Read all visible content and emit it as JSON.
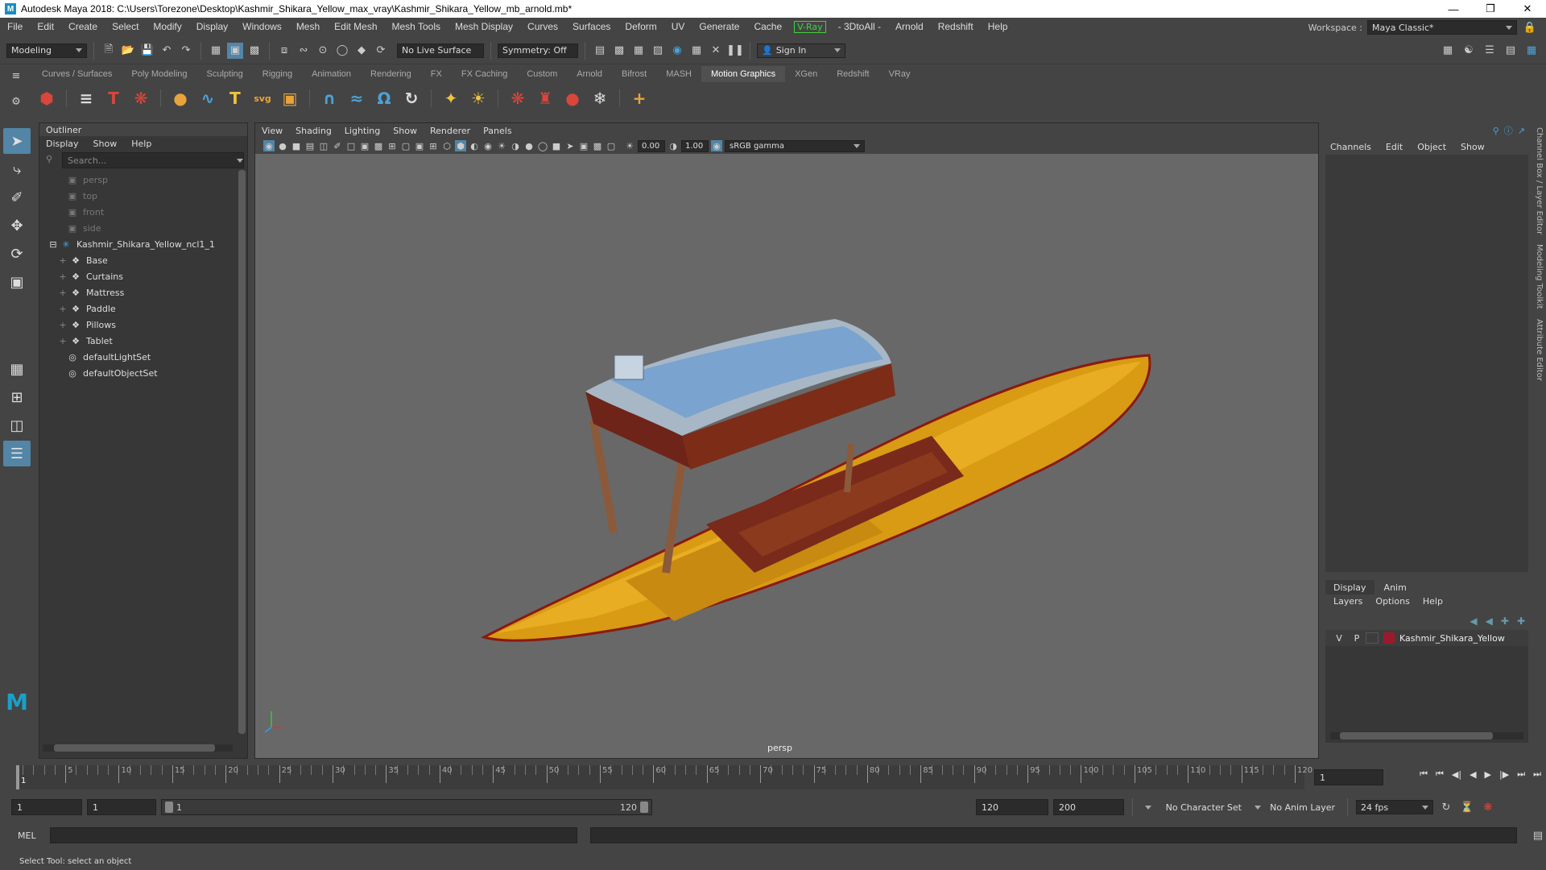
{
  "window": {
    "title": "Autodesk Maya 2018: C:\\Users\\Torezone\\Desktop\\Kashmir_Shikara_Yellow_max_vray\\Kashmir_Shikara_Yellow_mb_arnold.mb*",
    "logo": "M"
  },
  "menubar": {
    "items": [
      "File",
      "Edit",
      "Create",
      "Select",
      "Modify",
      "Display",
      "Windows",
      "Mesh",
      "Edit Mesh",
      "Mesh Tools",
      "Mesh Display",
      "Curves",
      "Surfaces",
      "Deform",
      "UV",
      "Generate",
      "Cache"
    ],
    "vray": "V-Ray",
    "items2": [
      "- 3DtoAll -",
      "Arnold",
      "Redshift",
      "Help"
    ],
    "workspace_label": "Workspace :",
    "workspace_value": "Maya Classic*"
  },
  "statusline": {
    "mode": "Modeling",
    "live_surface": "No Live Surface",
    "symmetry": "Symmetry: Off",
    "sign_in": "Sign In"
  },
  "shelf": {
    "tabs": [
      "Curves / Surfaces",
      "Poly Modeling",
      "Sculpting",
      "Rigging",
      "Animation",
      "Rendering",
      "FX",
      "FX Caching",
      "Custom",
      "Arnold",
      "Bifrost",
      "MASH",
      "Motion Graphics",
      "XGen",
      "Redshift",
      "VRay"
    ],
    "active_tab": "Motion Graphics",
    "colors": {
      "orange": "#e8a33a",
      "red": "#d9463c",
      "yellow": "#f0c23c"
    }
  },
  "outliner": {
    "title": "Outliner",
    "menus": [
      "Display",
      "Show",
      "Help"
    ],
    "search_placeholder": "Search...",
    "cameras": [
      "persp",
      "top",
      "front",
      "side"
    ],
    "group": "Kashmir_Shikara_Yellow_ncl1_1",
    "children": [
      "Base",
      "Curtains",
      "Mattress",
      "Paddle",
      "Pillows",
      "Tablet"
    ],
    "sets": [
      "defaultLightSet",
      "defaultObjectSet"
    ]
  },
  "viewport": {
    "menus": [
      "View",
      "Shading",
      "Lighting",
      "Show",
      "Renderer",
      "Panels"
    ],
    "exposure": "0.00",
    "gamma": "1.00",
    "colorspace": "sRGB gamma",
    "camera": "persp",
    "colors": {
      "hull": "#d99a14",
      "roof": "#7aa3cf",
      "fabric": "#7a2a1a"
    }
  },
  "channelbox": {
    "menus": [
      "Channels",
      "Edit",
      "Object",
      "Show"
    ],
    "tabs": [
      "Display",
      "Anim"
    ],
    "layer_menus": [
      "Layers",
      "Options",
      "Help"
    ],
    "layer": {
      "v": "V",
      "p": "P",
      "name": "Kashmir_Shikara_Yellow",
      "color": "#9b1a2a"
    },
    "side_tabs": [
      "Channel Box / Layer Editor",
      "Modeling Toolkit",
      "Attribute Editor"
    ]
  },
  "timeline": {
    "labels": [
      "5",
      "10",
      "15",
      "20",
      "25",
      "30",
      "35",
      "40",
      "45",
      "50",
      "55",
      "60",
      "65",
      "70",
      "75",
      "80",
      "85",
      "90",
      "95",
      "100",
      "105",
      "110",
      "115",
      "120"
    ],
    "current": "1",
    "current_frame_field": "1"
  },
  "range": {
    "start": "1",
    "start2": "1",
    "slider_start": "1",
    "slider_end": "120",
    "end": "120",
    "end2": "200",
    "character_set": "No Character Set",
    "anim_layer": "No Anim Layer",
    "fps": "24 fps"
  },
  "cmdline": {
    "label": "MEL"
  },
  "helpline": {
    "text": "Select Tool: select an object"
  }
}
